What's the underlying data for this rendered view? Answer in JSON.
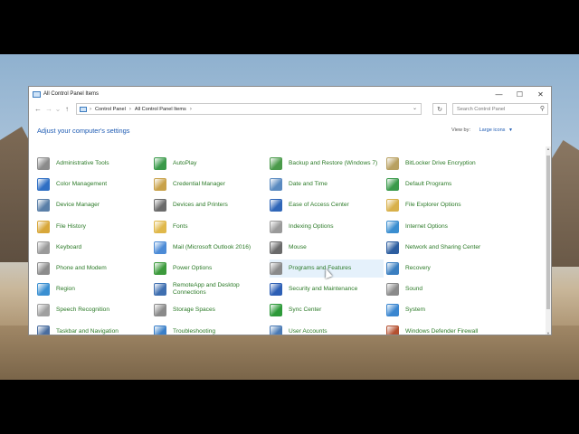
{
  "window": {
    "title": "All Control Panel Items"
  },
  "window_controls": {
    "minimize": "—",
    "maximize": "☐",
    "close": "✕"
  },
  "nav": {
    "back": "←",
    "forward": "→",
    "dropdown": "⌄",
    "up": "↑",
    "refresh": "↻"
  },
  "address": {
    "crumbs": [
      "Control Panel",
      "All Control Panel Items"
    ],
    "separator": "›"
  },
  "search": {
    "placeholder": "Search Control Panel"
  },
  "heading": "Adjust your computer's settings",
  "view_by": {
    "label": "View by:",
    "value": "Large icons"
  },
  "columns": [
    [
      {
        "label": "Administrative Tools",
        "icon": "admin-tools-icon",
        "color": "#8b8b8b"
      },
      {
        "label": "Color Management",
        "icon": "color-management-icon",
        "color": "#2f6fc4"
      },
      {
        "label": "Device Manager",
        "icon": "device-manager-icon",
        "color": "#5a7fa8"
      },
      {
        "label": "File History",
        "icon": "file-history-icon",
        "color": "#d8a73a"
      },
      {
        "label": "Keyboard",
        "icon": "keyboard-icon",
        "color": "#9a9a9a"
      },
      {
        "label": "Phone and Modem",
        "icon": "phone-modem-icon",
        "color": "#8c8c8c"
      },
      {
        "label": "Region",
        "icon": "region-icon",
        "color": "#3a8fd1"
      },
      {
        "label": "Speech Recognition",
        "icon": "speech-recognition-icon",
        "color": "#a0a0a0"
      },
      {
        "label": "Taskbar and Navigation",
        "icon": "taskbar-icon",
        "color": "#4a6d9e"
      }
    ],
    [
      {
        "label": "AutoPlay",
        "icon": "autoplay-icon",
        "color": "#3a9a4a"
      },
      {
        "label": "Credential Manager",
        "icon": "credential-manager-icon",
        "color": "#c9a24a"
      },
      {
        "label": "Devices and Printers",
        "icon": "devices-printers-icon",
        "color": "#6b6b6b"
      },
      {
        "label": "Fonts",
        "icon": "fonts-icon",
        "color": "#e0b84a"
      },
      {
        "label": "Mail (Microsoft Outlook 2016)",
        "icon": "mail-icon",
        "color": "#4c8bd6"
      },
      {
        "label": "Power Options",
        "icon": "power-options-icon",
        "color": "#3c9a3c"
      },
      {
        "label": "RemoteApp and Desktop Connections",
        "icon": "remoteapp-icon",
        "color": "#3f6fb0"
      },
      {
        "label": "Storage Spaces",
        "icon": "storage-spaces-icon",
        "color": "#8a8a8a"
      },
      {
        "label": "Troubleshooting",
        "icon": "troubleshooting-icon",
        "color": "#3a7fc8"
      }
    ],
    [
      {
        "label": "Backup and Restore (Windows 7)",
        "icon": "backup-restore-icon",
        "color": "#4a9a4a"
      },
      {
        "label": "Date and Time",
        "icon": "date-time-icon",
        "color": "#5a8ac0"
      },
      {
        "label": "Ease of Access Center",
        "icon": "ease-of-access-icon",
        "color": "#2f66b8"
      },
      {
        "label": "Indexing Options",
        "icon": "indexing-options-icon",
        "color": "#9a9a9a"
      },
      {
        "label": "Mouse",
        "icon": "mouse-icon",
        "color": "#6a6a6a"
      },
      {
        "label": "Programs and Features",
        "icon": "programs-features-icon",
        "color": "#8a8a8a",
        "highlighted": true
      },
      {
        "label": "Security and Maintenance",
        "icon": "security-maintenance-icon",
        "color": "#2d5fb5"
      },
      {
        "label": "Sync Center",
        "icon": "sync-center-icon",
        "color": "#2e9a3a"
      },
      {
        "label": "User Accounts",
        "icon": "user-accounts-icon",
        "color": "#4a7ab5"
      }
    ],
    [
      {
        "label": "BitLocker Drive Encryption",
        "icon": "bitlocker-icon",
        "color": "#b8a060"
      },
      {
        "label": "Default Programs",
        "icon": "default-programs-icon",
        "color": "#3a9a4a"
      },
      {
        "label": "File Explorer Options",
        "icon": "file-explorer-options-icon",
        "color": "#d8b04a"
      },
      {
        "label": "Internet Options",
        "icon": "internet-options-icon",
        "color": "#3a8ed0"
      },
      {
        "label": "Network and Sharing Center",
        "icon": "network-sharing-icon",
        "color": "#2c5d9f"
      },
      {
        "label": "Recovery",
        "icon": "recovery-icon",
        "color": "#3a7ec0"
      },
      {
        "label": "Sound",
        "icon": "sound-icon",
        "color": "#8a8a8a"
      },
      {
        "label": "System",
        "icon": "system-icon",
        "color": "#3a86d0"
      },
      {
        "label": "Windows Defender Firewall",
        "icon": "firewall-icon",
        "color": "#b45030"
      }
    ]
  ]
}
